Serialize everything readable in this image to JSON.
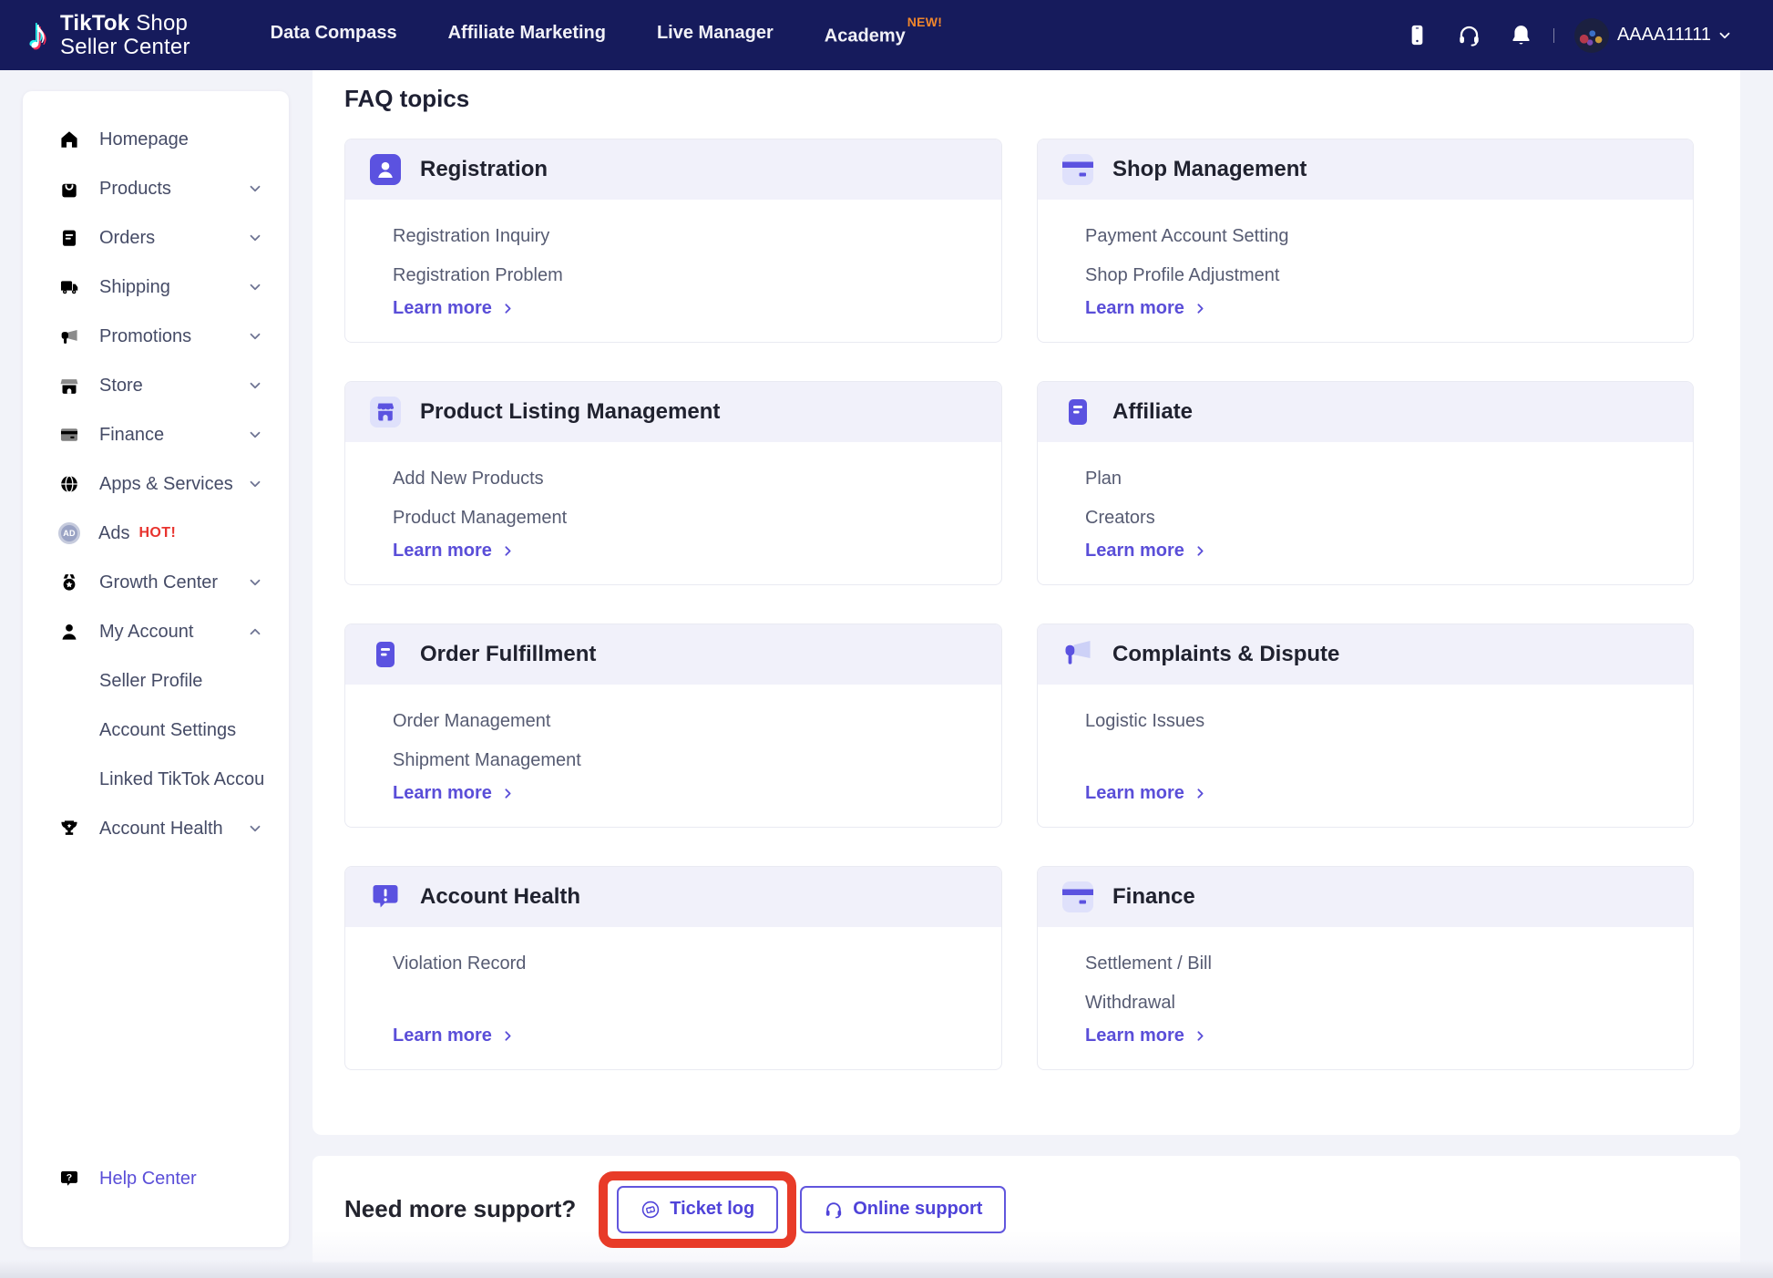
{
  "header": {
    "brand": {
      "bold": "TikTok",
      "shop": "Shop",
      "line2": "Seller Center"
    },
    "nav": [
      {
        "label": "Data Compass"
      },
      {
        "label": "Affiliate Marketing"
      },
      {
        "label": "Live Manager"
      },
      {
        "label": "Academy",
        "badge": "NEW!"
      }
    ],
    "user": {
      "name": "AAAA11111"
    }
  },
  "sidebar": {
    "items": [
      {
        "label": "Homepage"
      },
      {
        "label": "Products"
      },
      {
        "label": "Orders"
      },
      {
        "label": "Shipping"
      },
      {
        "label": "Promotions"
      },
      {
        "label": "Store"
      },
      {
        "label": "Finance"
      },
      {
        "label": "Apps & Services"
      },
      {
        "label": "Ads",
        "badge": "HOT!",
        "icon_text": "AD"
      },
      {
        "label": "Growth Center"
      },
      {
        "label": "My Account"
      },
      {
        "label": "Seller Profile"
      },
      {
        "label": "Account Settings"
      },
      {
        "label": "Linked TikTok Accou..."
      },
      {
        "label": "Account Health"
      }
    ],
    "help_label": "Help Center"
  },
  "faq": {
    "section_title": "FAQ topics",
    "learn_more_label": "Learn more",
    "cards": [
      {
        "title": "Registration",
        "items": [
          "Registration Inquiry",
          "Registration Problem"
        ]
      },
      {
        "title": "Shop Management",
        "items": [
          "Payment Account Setting",
          "Shop Profile Adjustment"
        ]
      },
      {
        "title": "Product Listing Management",
        "items": [
          "Add New Products",
          "Product Management"
        ]
      },
      {
        "title": "Affiliate",
        "items": [
          "Plan",
          "Creators"
        ]
      },
      {
        "title": "Order Fulfillment",
        "items": [
          "Order Management",
          "Shipment Management"
        ]
      },
      {
        "title": "Complaints & Dispute",
        "items": [
          "Logistic Issues"
        ]
      },
      {
        "title": "Account Health",
        "items": [
          "Violation Record"
        ]
      },
      {
        "title": "Finance",
        "items": [
          "Settlement / Bill",
          "Withdrawal"
        ]
      }
    ]
  },
  "support": {
    "prompt": "Need more support?",
    "ticket_label": "Ticket log",
    "online_label": "Online support"
  },
  "colors": {
    "navy": "#161b5c",
    "accent_purple": "#5a4ed8",
    "icon_purple": "#5b52e0",
    "hot_red": "#e8332e",
    "annotation_red": "#e83b28",
    "badge_orange": "#f0862c"
  }
}
